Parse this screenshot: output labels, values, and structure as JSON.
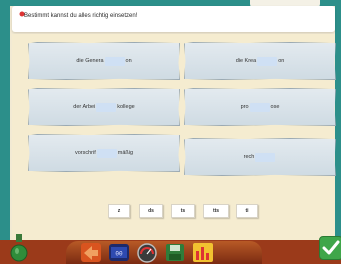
{
  "instruction": {
    "text": "Bestimmt kannst du alles richtig einsetzen!"
  },
  "cards": [
    {
      "before": "die Genera",
      "after": "on"
    },
    {
      "before": "die Krea",
      "after": "on"
    },
    {
      "before": "der Arbei",
      "after": "kollege"
    },
    {
      "before": "pro",
      "after": "ose"
    },
    {
      "before": "vorschrif",
      "after": "mäßig"
    },
    {
      "before": "rech",
      "after": ""
    }
  ],
  "choices": [
    "z",
    "ds",
    "ts",
    "tts",
    "ti"
  ],
  "toolbar": {
    "icons": [
      "back-arrow-icon",
      "timer-display-icon",
      "speedometer-icon",
      "save-disk-icon",
      "statistics-icon"
    ]
  },
  "colors": {
    "frame": "#2c8f8a",
    "gap": "#cfe0f4",
    "check": "#3fa64a",
    "toolbar": "#9b3a1a"
  }
}
